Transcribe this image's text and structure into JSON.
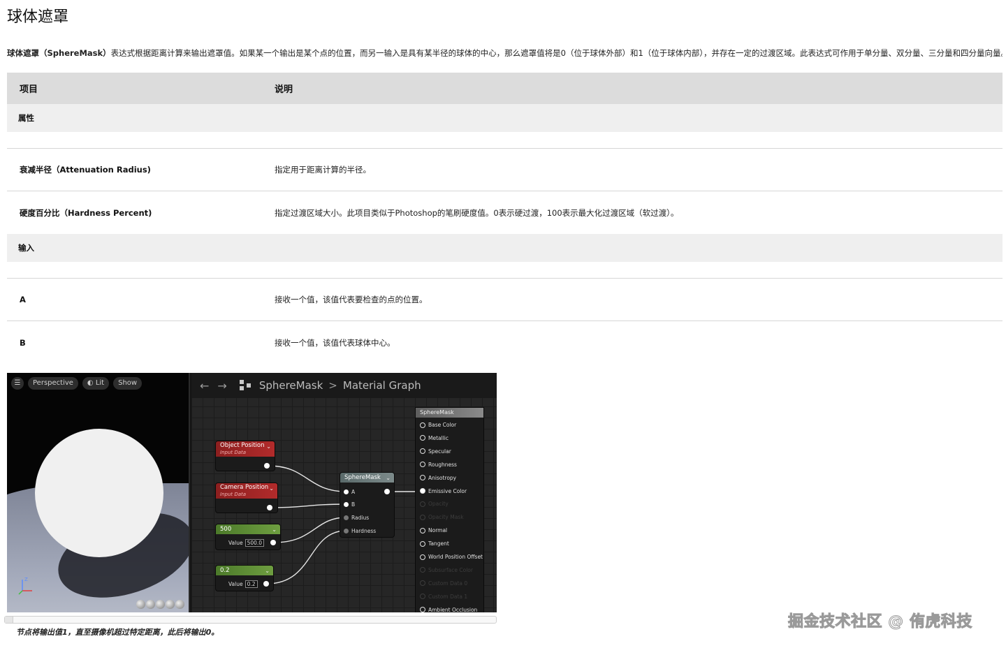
{
  "page": {
    "title": "球体遮罩",
    "intro_bold": "球体遮罩（SphereMask）",
    "intro_text": "表达式根据距离计算来输出遮罩值。如果某一个输出是某个点的位置，而另一输入是具有某半径的球体的中心，那么遮罩值将是0（位于球体外部）和1（位于球体内部），并存在一定的过渡区域。此表达式可作用于单分量、双分量、三分量和四分量向量。"
  },
  "table": {
    "headers": [
      "项目",
      "说明"
    ],
    "sections": [
      {
        "title": "属性",
        "rows": [
          {
            "item": "衰减半径（Attenuation Radius)",
            "desc": "指定用于距离计算的半径。"
          },
          {
            "item": "硬度百分比（Hardness Percent)",
            "desc": "指定过渡区域大小。此项目类似于Photoshop的笔刷硬度值。0表示硬过渡，100表示最大化过渡区域（软过渡）。"
          }
        ]
      },
      {
        "title": "输入",
        "rows": [
          {
            "item": "A",
            "desc": "接收一个值，该值代表要检查的点的位置。"
          },
          {
            "item": "B",
            "desc": "接收一个值，该值代表球体中心。"
          }
        ]
      }
    ]
  },
  "editor": {
    "viewport": {
      "menu_icon": "hamburger-icon",
      "perspective": "Perspective",
      "lit": "Lit",
      "show": "Show",
      "axis_label": "Z"
    },
    "graph": {
      "back_icon": "arrow-left-icon",
      "forward_icon": "arrow-right-icon",
      "graph_icon": "graph-icon",
      "crumb_1": "SphereMask",
      "crumb_sep": ">",
      "crumb_2": "Material Graph",
      "nodes": {
        "object_position": {
          "title": "Object Position",
          "subtitle": "Input Data"
        },
        "camera_position": {
          "title": "Camera Position",
          "subtitle": "Input Data"
        },
        "const_500": {
          "title": "500",
          "value_label": "Value",
          "value": "500.0"
        },
        "const_02": {
          "title": "0.2",
          "value_label": "Value",
          "value": "0.2"
        },
        "spheremask": {
          "title": "SphereMask",
          "pins": [
            "A",
            "B",
            "Radius",
            "Hardness"
          ]
        }
      },
      "result": {
        "title": "SphereMask",
        "pins": [
          {
            "label": "Base Color",
            "active": true
          },
          {
            "label": "Metallic",
            "active": true
          },
          {
            "label": "Specular",
            "active": true
          },
          {
            "label": "Roughness",
            "active": true
          },
          {
            "label": "Anisotropy",
            "active": true
          },
          {
            "label": "Emissive Color",
            "active": true
          },
          {
            "label": "Opacity",
            "active": false
          },
          {
            "label": "Opacity Mask",
            "active": false
          },
          {
            "label": "Normal",
            "active": true
          },
          {
            "label": "Tangent",
            "active": true
          },
          {
            "label": "World Position Offset",
            "active": true
          },
          {
            "label": "Subsurface Color",
            "active": false
          },
          {
            "label": "Custom Data 0",
            "active": false
          },
          {
            "label": "Custom Data 1",
            "active": false
          },
          {
            "label": "Ambient Occlusion",
            "active": true
          }
        ]
      }
    }
  },
  "caption": "节点将输出值1，直至摄像机超过特定距离，此后将输出0。",
  "watermark": "掘金技术社区 @ 侑虎科技"
}
